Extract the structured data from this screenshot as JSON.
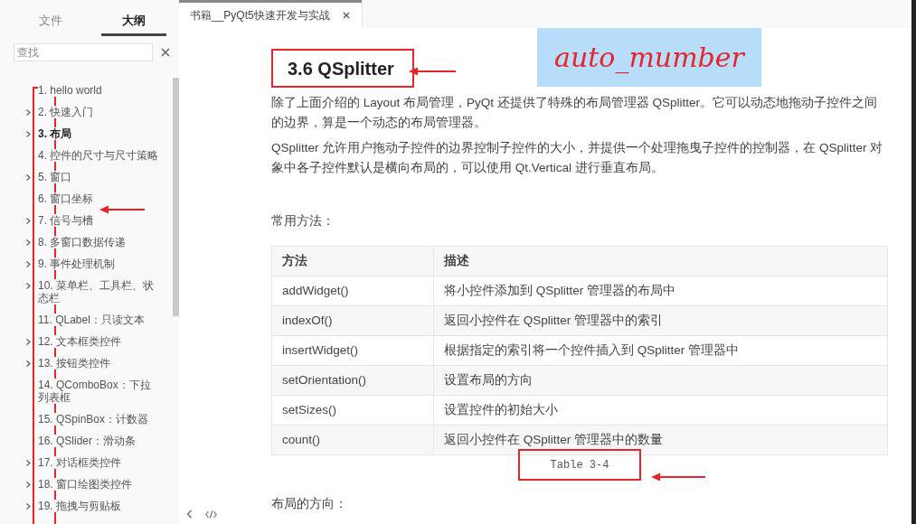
{
  "sidebar": {
    "tabs": [
      {
        "label": "文件",
        "selected": false
      },
      {
        "label": "大纲",
        "selected": true
      }
    ],
    "search": {
      "placeholder": "查找"
    },
    "outline": [
      {
        "label": "1. hello world",
        "collapsible": false,
        "selected": false
      },
      {
        "label": "2. 快速入门",
        "collapsible": true,
        "selected": false
      },
      {
        "label": "3. 布局",
        "collapsible": true,
        "selected": true
      },
      {
        "label": "4. 控件的尺寸与尺寸策略",
        "collapsible": false,
        "selected": false
      },
      {
        "label": "5. 窗口",
        "collapsible": true,
        "selected": false
      },
      {
        "label": "6. 窗口坐标",
        "collapsible": false,
        "selected": false
      },
      {
        "label": "7. 信号与槽",
        "collapsible": true,
        "selected": false
      },
      {
        "label": "8. 多窗口数据传递",
        "collapsible": true,
        "selected": false
      },
      {
        "label": "9. 事件处理机制",
        "collapsible": true,
        "selected": false
      },
      {
        "label": "10. 菜单栏、工具栏、状态栏",
        "collapsible": true,
        "selected": false
      },
      {
        "label": "11. QLabel：只读文本",
        "collapsible": false,
        "selected": false
      },
      {
        "label": "12. 文本框类控件",
        "collapsible": true,
        "selected": false
      },
      {
        "label": "13. 按钮类控件",
        "collapsible": true,
        "selected": false
      },
      {
        "label": "14. QComboBox：下拉列表框",
        "collapsible": false,
        "selected": false
      },
      {
        "label": "15. QSpinBox：计数器",
        "collapsible": false,
        "selected": false
      },
      {
        "label": "16. QSlider：滑动条",
        "collapsible": false,
        "selected": false
      },
      {
        "label": "17. 对话框类控件",
        "collapsible": true,
        "selected": false
      },
      {
        "label": "18. 窗口绘图类控件",
        "collapsible": true,
        "selected": false
      },
      {
        "label": "19. 拖拽与剪贴板",
        "collapsible": true,
        "selected": false
      }
    ]
  },
  "editor": {
    "tab": {
      "title": "书籍__PyQt5快速开发与实战"
    },
    "heading": "3.6 QSplitter",
    "paragraphs": [
      "除了上面介绍的 Layout 布局管理，PyQt 还提供了特殊的布局管理器 QSplitter。它可以动态地拖动子控件之间的边界，算是一个动态的布局管理器。",
      "QSplitter 允许用户拖动子控件的边界控制子控件的大小，并提供一个处理拖曳子控件的控制器，在 QSplitter 对象中各子控件默认是横向布局的，可以使用 Qt.Vertical 进行垂直布局。"
    ],
    "table_intro": "常用方法：",
    "table": {
      "columns": [
        "方法",
        "描述"
      ],
      "rows": [
        [
          "addWidget()",
          "将小控件添加到 QSplitter 管理器的布局中"
        ],
        [
          "indexOf()",
          "返回小控件在 QSplitter 管理器中的索引"
        ],
        [
          "insertWidget()",
          "根据指定的索引将一个控件插入到 QSplitter 管理器中"
        ],
        [
          "setOrientation()",
          "设置布局的方向"
        ],
        [
          "setSizes()",
          "设置控件的初始大小"
        ],
        [
          "count()",
          "返回小控件在 QSplitter 管理器中的数量"
        ]
      ]
    },
    "caption": "Table 3-4",
    "next_text": "布局的方向："
  },
  "annotation": {
    "label": "auto_mumber"
  }
}
